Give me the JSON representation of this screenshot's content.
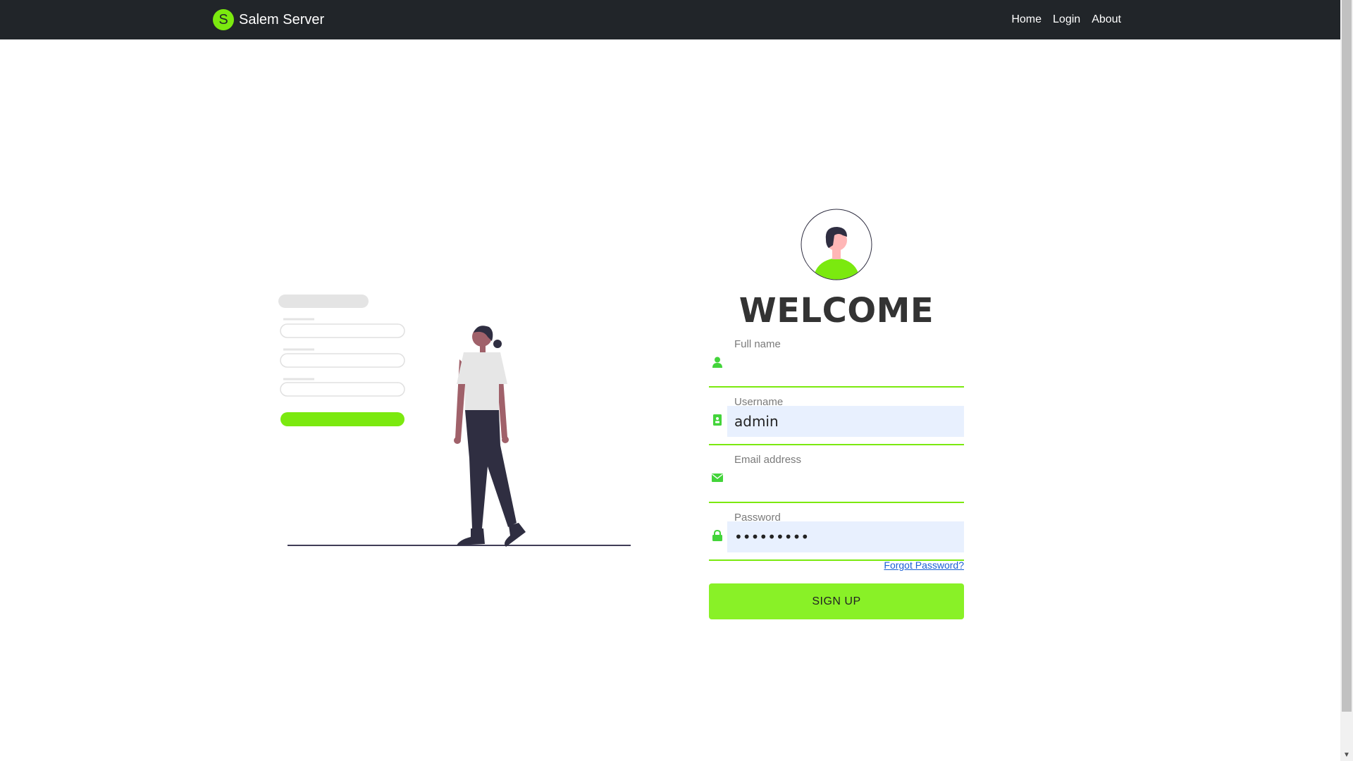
{
  "navbar": {
    "logo_letter": "S",
    "brand": "Salem Server",
    "links": [
      "Home",
      "Login",
      "About"
    ]
  },
  "form": {
    "heading": "WELCOME",
    "fields": [
      {
        "label": "Full name",
        "value": "",
        "icon": "user-icon"
      },
      {
        "label": "Username",
        "value": "admin",
        "icon": "id-card-icon"
      },
      {
        "label": "Email address",
        "value": "",
        "icon": "envelope-icon"
      },
      {
        "label": "Password",
        "value": "•••••••••",
        "icon": "lock-icon"
      }
    ],
    "forgot_link": "Forgot Password?",
    "submit_label": "SIGN UP"
  },
  "colors": {
    "accent": "#7be90f",
    "button": "#89f127",
    "navbar": "#212529",
    "autofill": "#e8f0fe"
  }
}
